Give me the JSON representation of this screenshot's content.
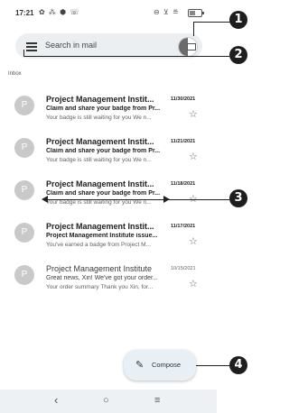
{
  "status_bar": {
    "time": "17:21",
    "left_icons": "✿ ⁂ ⬢ ☏",
    "right_icons": "⊖ ⊻ ≝"
  },
  "search": {
    "placeholder": "Search in mail"
  },
  "section_label": "Inbox",
  "emails": [
    {
      "avatar": "P",
      "sender": "Project Management Instit...",
      "date": "11/30/2021",
      "subject": "Claim and share your badge from Pr...",
      "snippet": "Your badge is still waiting for you We n...",
      "unread": true
    },
    {
      "avatar": "P",
      "sender": "Project Management Instit...",
      "date": "11/21/2021",
      "subject": "Claim and share your badge from Pr...",
      "snippet": "Your badge is still waiting for you We n...",
      "unread": true
    },
    {
      "avatar": "P",
      "sender": "Project Management Instit...",
      "date": "11/18/2021",
      "subject": "Claim and share your badge from Pr...",
      "snippet": "Your badge is still waiting for you We n...",
      "unread": true
    },
    {
      "avatar": "P",
      "sender": "Project Management Instit...",
      "date": "11/17/2021",
      "subject": "Project Management Institute issue...",
      "snippet": "You've earned a badge from Project M...",
      "unread": true
    },
    {
      "avatar": "P",
      "sender": "Project Management Institute",
      "date": "10/15/2021",
      "subject": "Great news, Xin! We've got your order...",
      "snippet": "Your order summary Thank you Xin, for...",
      "unread": false
    }
  ],
  "compose": {
    "label": "Compose",
    "icon": "pencil-icon"
  },
  "nav_bar": {
    "back": "‹",
    "home": "○",
    "recents": "≡"
  },
  "callouts": [
    "1",
    "2",
    "3",
    "4"
  ]
}
